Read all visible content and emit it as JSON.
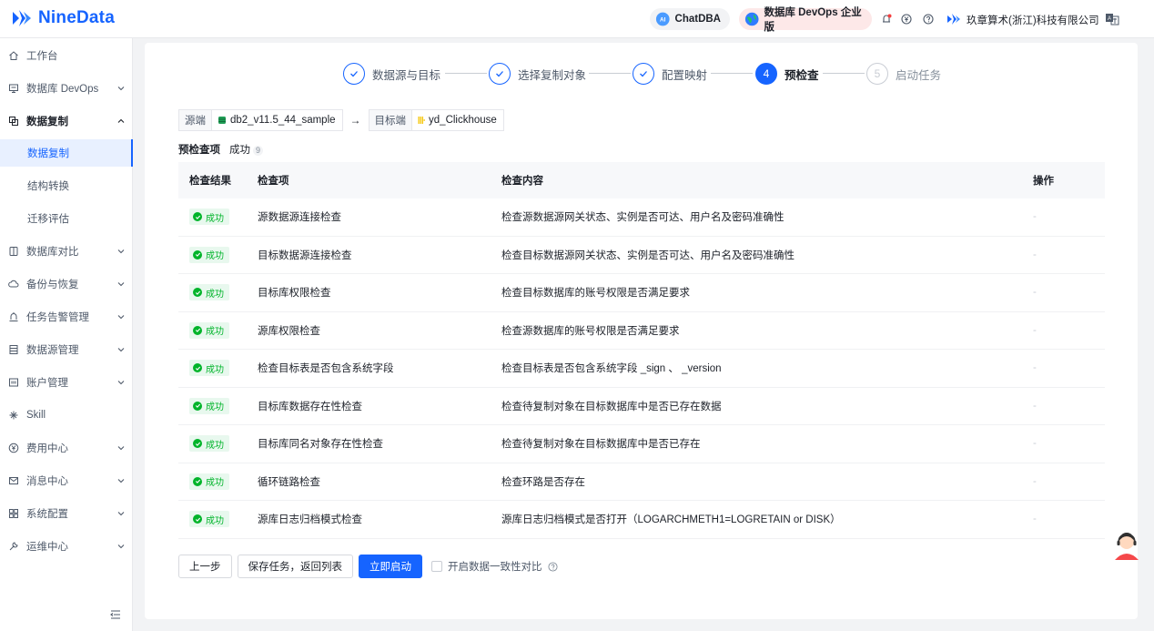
{
  "brand": {
    "name": "NineData"
  },
  "topbar": {
    "chatdba": "ChatDBA",
    "edition": "数据库 DevOps 企业版",
    "company": "玖章算术(浙江)科技有限公司"
  },
  "sidebar": {
    "items": [
      {
        "label": "工作台",
        "icon": "home-icon"
      },
      {
        "label": "数据库 DevOps",
        "icon": "monitor-icon"
      },
      {
        "label": "数据复制",
        "icon": "copy-icon"
      },
      {
        "label": "数据库对比",
        "icon": "compare-icon"
      },
      {
        "label": "备份与恢复",
        "icon": "cloud-icon"
      },
      {
        "label": "任务告警管理",
        "icon": "bell-icon"
      },
      {
        "label": "数据源管理",
        "icon": "database-icon"
      },
      {
        "label": "账户管理",
        "icon": "user-card-icon"
      },
      {
        "label": "Skill",
        "icon": "skill-icon"
      },
      {
        "label": "费用中心",
        "icon": "yen-icon"
      },
      {
        "label": "消息中心",
        "icon": "mail-icon"
      },
      {
        "label": "系统配置",
        "icon": "grid-icon"
      },
      {
        "label": "运维中心",
        "icon": "wrench-icon"
      }
    ],
    "sub_items": [
      "数据复制",
      "结构转换",
      "迁移评估"
    ]
  },
  "steps": [
    {
      "label": "数据源与目标",
      "state": "done"
    },
    {
      "label": "选择复制对象",
      "state": "done"
    },
    {
      "label": "配置映射",
      "state": "done"
    },
    {
      "label": "预检查",
      "state": "current",
      "num": "4"
    },
    {
      "label": "启动任务",
      "state": "todo",
      "num": "5"
    }
  ],
  "path": {
    "source_key": "源端",
    "source_value": "db2_v11.5_44_sample",
    "arrow": "→",
    "target_key": "目标端",
    "target_value": "yd_Clickhouse"
  },
  "summary": {
    "title": "预检查项",
    "status": "成功",
    "count": "9"
  },
  "table": {
    "headers": [
      "检查结果",
      "检查项",
      "检查内容",
      "操作"
    ],
    "rows": [
      {
        "result": "成功",
        "item": "源数据源连接检查",
        "content": "检查源数据源网关状态、实例是否可达、用户名及密码准确性",
        "op": "-"
      },
      {
        "result": "成功",
        "item": "目标数据源连接检查",
        "content": "检查目标数据源网关状态、实例是否可达、用户名及密码准确性",
        "op": "-"
      },
      {
        "result": "成功",
        "item": "目标库权限检查",
        "content": "检查目标数据库的账号权限是否满足要求",
        "op": "-"
      },
      {
        "result": "成功",
        "item": "源库权限检查",
        "content": "检查源数据库的账号权限是否满足要求",
        "op": "-"
      },
      {
        "result": "成功",
        "item": "检查目标表是否包含系统字段",
        "content": "检查目标表是否包含系统字段 _sign 、 _version",
        "op": "-"
      },
      {
        "result": "成功",
        "item": "目标库数据存在性检查",
        "content": "检查待复制对象在目标数据库中是否已存在数据",
        "op": "-"
      },
      {
        "result": "成功",
        "item": "目标库同名对象存在性检查",
        "content": "检查待复制对象在目标数据库中是否已存在",
        "op": "-"
      },
      {
        "result": "成功",
        "item": "循环链路检查",
        "content": "检查环路是否存在",
        "op": "-"
      },
      {
        "result": "成功",
        "item": "源库日志归档模式检查",
        "content": "源库日志归档模式是否打开（LOGARCHMETH1=LOGRETAIN or DISK）",
        "op": "-"
      }
    ]
  },
  "actions": {
    "prev": "上一步",
    "save": "保存任务，返回列表",
    "start": "立即启动",
    "consistency": "开启数据一致性对比"
  },
  "colors": {
    "primary": "#1664ff",
    "success": "#00b42a"
  }
}
